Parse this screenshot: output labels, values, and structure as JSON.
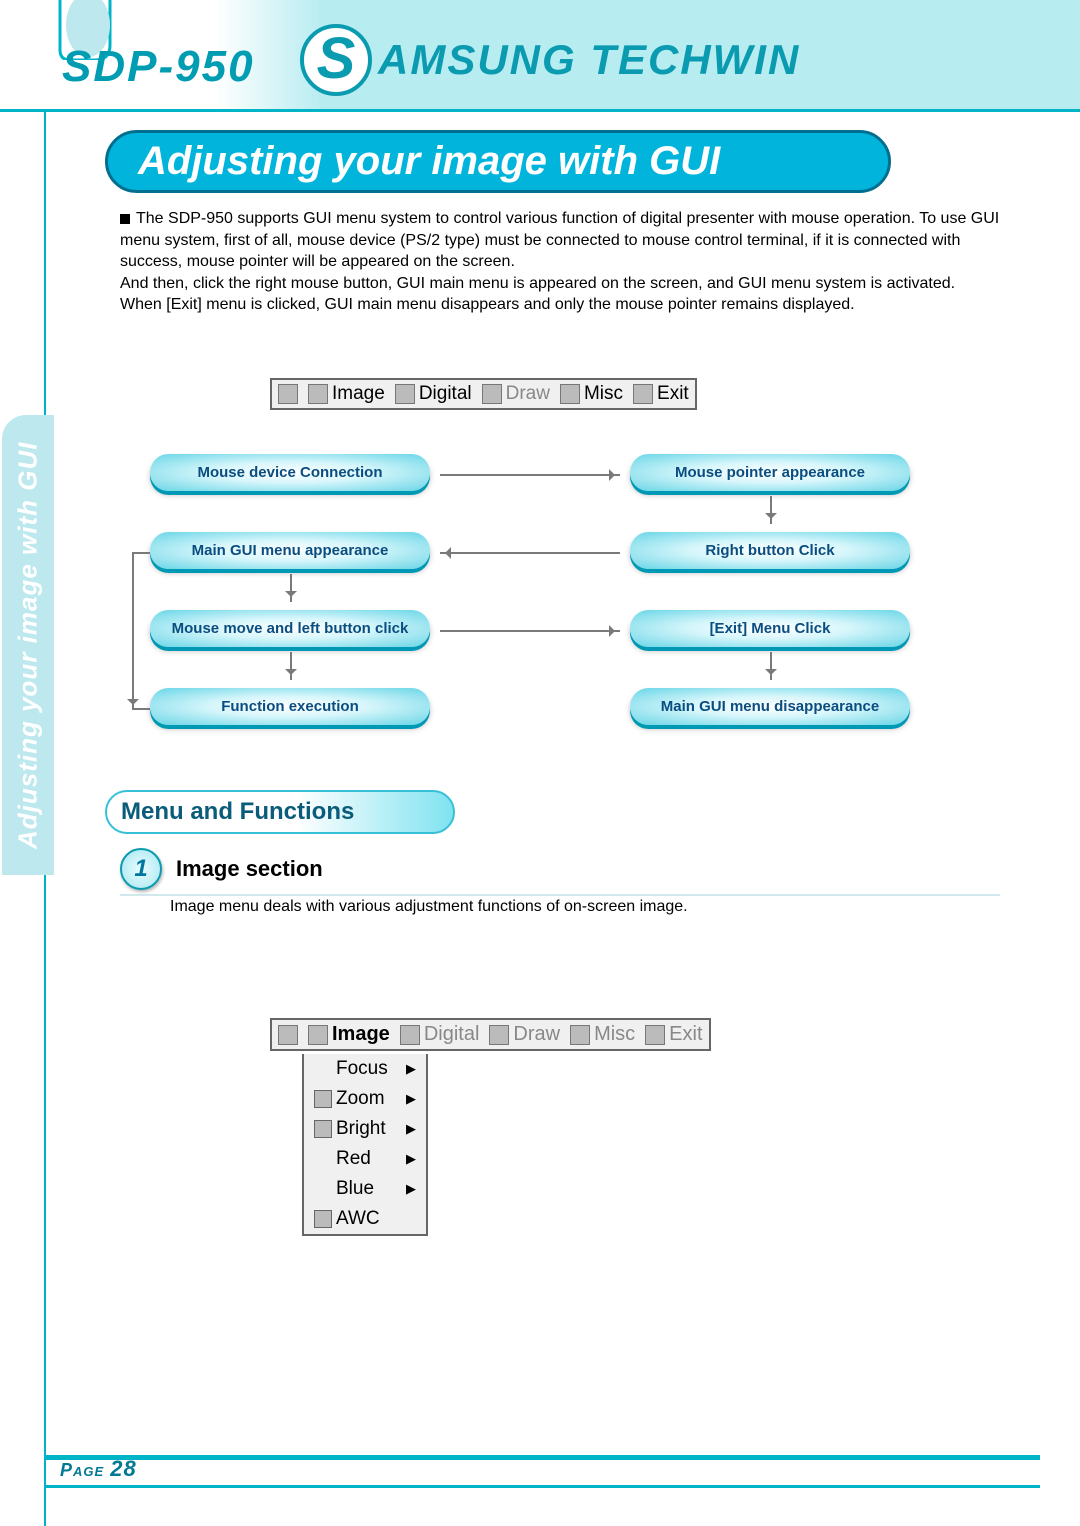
{
  "header": {
    "model": "SDP-950",
    "brand_s": "S",
    "brand_rest": "AMSUNG TECHWIN"
  },
  "title": "Adjusting your image with GUI",
  "side_tab": "Adjusting your image with GUI",
  "intro": {
    "p1": "The SDP-950 supports GUI menu system to control various function of digital presenter with mouse operation. To use GUI menu system, first of all, mouse device (PS/2 type) must be connected to mouse control terminal, if it is connected with success, mouse pointer will be appeared on the screen.",
    "p2": "And then, click the right mouse button, GUI main menu is appeared on the screen, and GUI menu system is activated.",
    "p3": "When [Exit] menu is clicked, GUI main menu disappears and only the mouse pointer remains displayed."
  },
  "menubar": {
    "items": [
      "Image",
      "Digital",
      "Draw",
      "Misc",
      "Exit"
    ]
  },
  "flow": {
    "l0": "Mouse device Connection",
    "r0": "Mouse pointer appearance",
    "l1": "Main GUI menu appearance",
    "r1": "Right button Click",
    "l2": "Mouse move and left button click",
    "r2": "[Exit] Menu Click",
    "l3": "Function execution",
    "r3": "Main GUI menu disappearance"
  },
  "section2": {
    "heading": "Menu and Functions",
    "step_num": "1",
    "step_title": "Image section",
    "step_desc": "Image menu deals with various adjustment functions of on-screen image."
  },
  "dropdown": {
    "items": [
      {
        "label": "Focus",
        "arrow": true,
        "icon": ""
      },
      {
        "label": "Zoom",
        "arrow": true,
        "icon": "zoom"
      },
      {
        "label": "Bright",
        "arrow": true,
        "icon": "bright"
      },
      {
        "label": "Red",
        "arrow": true,
        "icon": ""
      },
      {
        "label": "Blue",
        "arrow": true,
        "icon": ""
      },
      {
        "label": "AWC",
        "arrow": false,
        "icon": "awc"
      }
    ]
  },
  "footer": {
    "page_label": "Page",
    "page_number": "28"
  }
}
